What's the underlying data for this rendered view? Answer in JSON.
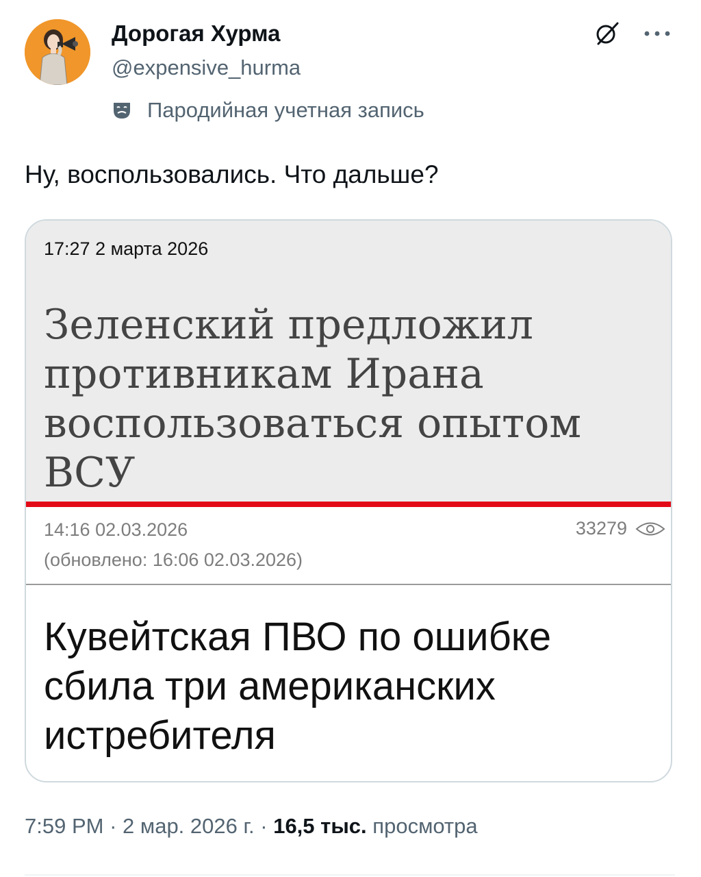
{
  "author": {
    "display_name": "Дорогая Хурма",
    "handle": "@expensive_hurma",
    "avatar_icon": "avatar-photo",
    "parody_label": "Пародийная учетная запись",
    "parody_icon": "theater-mask-icon"
  },
  "header_actions": {
    "grok_icon": "grok-icon",
    "more_icon": "more-dots-icon"
  },
  "tweet": {
    "text": "Ну, воспользовались. Что дальше?"
  },
  "media_card": {
    "article_1": {
      "datetime": "17:27  2 марта 2026",
      "headline_lines": [
        "Зеленский предложил",
        "противникам Ирана",
        "воспользоваться опытом",
        "ВСУ"
      ],
      "accent_color": "#e30a17"
    },
    "meta": {
      "published": "14:16 02.03.2026",
      "updated": "(обновлено: 16:06 02.03.2026)",
      "views": "33279",
      "views_icon": "eye-icon"
    },
    "article_2": {
      "headline_lines": [
        "Кувейтская ПВО по ошибке",
        "сбила три американских",
        "истребителя"
      ]
    }
  },
  "footer": {
    "time": "7:59 PM",
    "separator": "·",
    "date": "2 мар. 2026 г.",
    "views_count": "16,5 тыс.",
    "views_label": "просмотра"
  },
  "colors": {
    "text_primary": "#0f1419",
    "text_secondary": "#536471",
    "card_border": "#cfd9de",
    "avatar_bg": "#f0962a"
  }
}
